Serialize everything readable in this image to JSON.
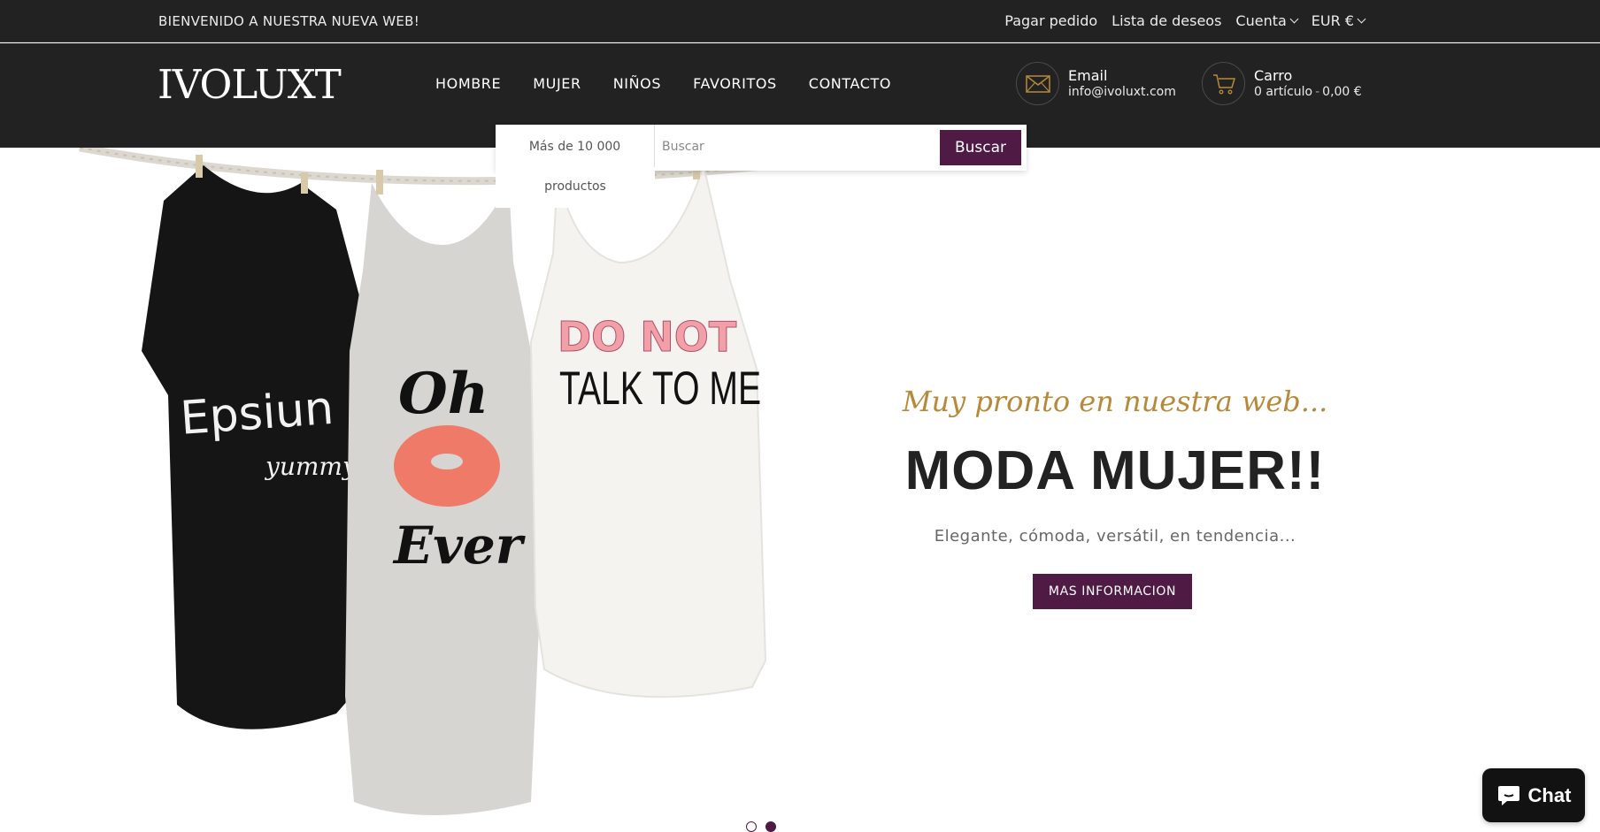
{
  "topbar": {
    "welcome": "BIENVENIDO A NUESTRA NUEVA WEB!",
    "links": {
      "pay_order": "Pagar pedido",
      "wishlist": "Lista de deseos",
      "account": "Cuenta",
      "currency": "EUR €"
    }
  },
  "header": {
    "logo": "IVOLUXT",
    "nav": [
      "HOMBRE",
      "MUJER",
      "NIÑOS",
      "FAVORITOS",
      "CONTACTO"
    ],
    "email": {
      "label": "Email",
      "value": "info@ivoluxt.com",
      "icon": "envelope-icon"
    },
    "cart": {
      "label": "Carro",
      "items": "0 artículo",
      "separator": "-",
      "total": "0,00 €",
      "icon": "cart-icon"
    }
  },
  "search": {
    "category_line1": "Más de 10 000",
    "category_line2": "productos",
    "placeholder": "Buscar",
    "button": "Buscar"
  },
  "hero": {
    "subtitle": "Muy pronto en nuestra web...",
    "title": "MODA MUJER!!",
    "description": "Elegante, cómoda, versátil, en tendencia...",
    "cta": "MAS INFORMACION",
    "shirts": [
      "Epsiun",
      "yummy",
      "Oh",
      "Ever",
      "DO NOT",
      "TALK TO ME"
    ],
    "slides": 2,
    "active_slide": 2
  },
  "chat": {
    "label": "Chat",
    "icon": "chat-bubble-icon"
  },
  "colors": {
    "dark_bg": "#222222",
    "accent_purple": "#4f1a43",
    "gold": "#b58a3a"
  }
}
